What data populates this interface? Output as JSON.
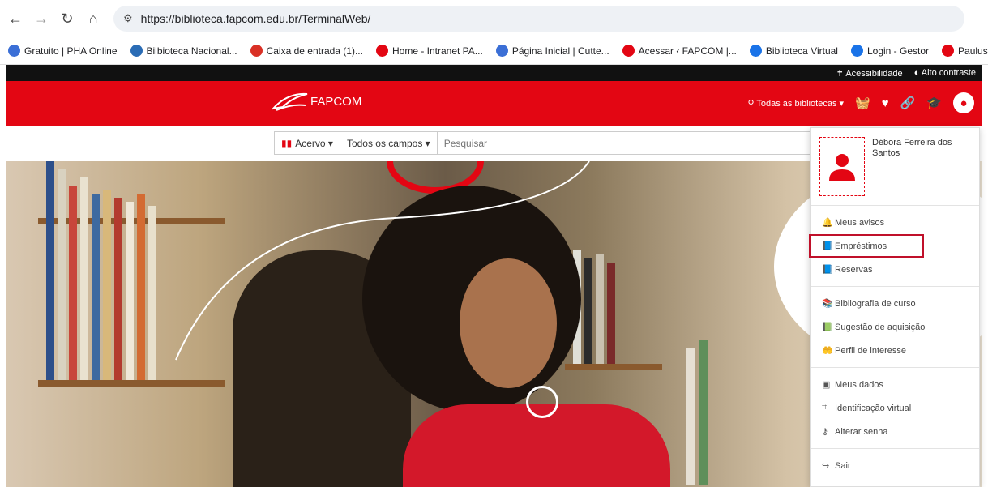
{
  "browser": {
    "url": "https://biblioteca.fapcom.edu.br/TerminalWeb/",
    "bookmarks": [
      {
        "label": "Gratuito | PHA Online",
        "color": "#3b6fd6"
      },
      {
        "label": "Bilbioteca Nacional...",
        "color": "#2a6cb5"
      },
      {
        "label": "Caixa de entrada (1)...",
        "color": "#d93025"
      },
      {
        "label": "Home - Intranet PA...",
        "color": "#e30613"
      },
      {
        "label": "Página Inicial | Cutte...",
        "color": "#3b6fd6"
      },
      {
        "label": "Acessar ‹ FAPCOM |...",
        "color": "#e30613"
      },
      {
        "label": "Biblioteca Virtual",
        "color": "#1a73e8"
      },
      {
        "label": "Login - Gestor",
        "color": "#1a73e8"
      },
      {
        "label": "Paulus Edi",
        "color": "#e30613"
      }
    ]
  },
  "topstrip": {
    "accessibility": "Acessibilidade",
    "contrast": "Alto contraste"
  },
  "header": {
    "logo": "FAPCOM",
    "libraries": "Todas as bibliotecas",
    "brand_color": "#e30613"
  },
  "search": {
    "collection": "Acervo",
    "fields": "Todos os campos",
    "placeholder": "Pesquisar"
  },
  "user_menu": {
    "user_name": "Débora Ferreira dos Santos",
    "groups": [
      [
        {
          "label": "Meus avisos",
          "icon": "bell-icon",
          "glyph": "🔔"
        },
        {
          "label": "Empréstimos",
          "icon": "book-icon",
          "glyph": "📘"
        },
        {
          "label": "Reservas",
          "icon": "book-icon",
          "glyph": "📘"
        }
      ],
      [
        {
          "label": "Bibliografia de curso",
          "icon": "books-icon",
          "glyph": "📚"
        },
        {
          "label": "Sugestão de aquisição",
          "icon": "book-suggest-icon",
          "glyph": "📗"
        },
        {
          "label": "Perfil de interesse",
          "icon": "interest-icon",
          "glyph": "🤲"
        }
      ],
      [
        {
          "label": "Meus dados",
          "icon": "id-card-icon",
          "glyph": "▣"
        },
        {
          "label": "Identificação virtual",
          "icon": "qr-icon",
          "glyph": "⌗"
        },
        {
          "label": "Alterar senha",
          "icon": "key-icon",
          "glyph": "⚷"
        }
      ],
      [
        {
          "label": "Sair",
          "icon": "sign-out-icon",
          "glyph": "↪"
        }
      ]
    ],
    "highlighted": "Empréstimos"
  }
}
